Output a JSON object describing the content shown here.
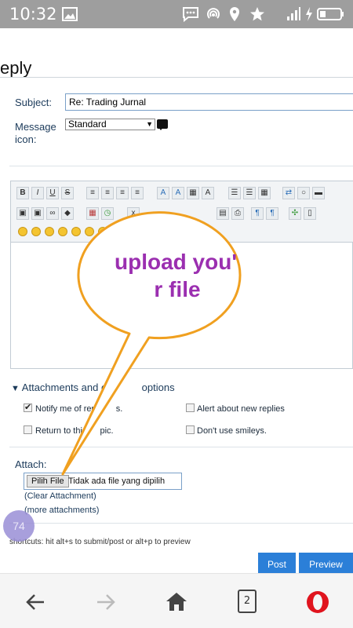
{
  "status_bar": {
    "time": "10:32"
  },
  "page": {
    "title": "eply",
    "subject_label": "Subject:",
    "subject_value": "Re: Trading Jurnal",
    "message_icon_label_1": "Message",
    "message_icon_label_2": "icon:",
    "message_icon_value": "Standard"
  },
  "editor": {
    "format_buttons": [
      "B",
      "I",
      "U",
      "S"
    ],
    "body_text": ""
  },
  "options": {
    "header": "Attachments and other options",
    "header_visible_1": "Attachments and oth",
    "header_visible_2": "options",
    "notify": {
      "label": "Notify me of replies.",
      "checked": true
    },
    "notify_visible_1": "Notify me of rep",
    "notify_visible_2": "s.",
    "alert": {
      "label": "Alert about new replies",
      "checked": false
    },
    "return": {
      "label": "Return to this topic.",
      "checked": false
    },
    "return_visible_1": "Return to this",
    "return_visible_2": "pic.",
    "smileys": {
      "label": "Don't use smileys.",
      "checked": false
    }
  },
  "attach": {
    "label": "Attach:",
    "button_label": "Pilih File",
    "no_file_text": "Tidak ada file yang dipilih",
    "clear_link": "(Clear Attachment)",
    "more_link": "(more attachments)"
  },
  "shortcuts_text": "shortcuts: hit alt+s to submit/post or alt+p to preview",
  "buttons": {
    "post": "Post",
    "preview": "Preview"
  },
  "floating_badge": "74",
  "callout": {
    "line1": "upload you'",
    "line2": "r file"
  },
  "navbar": {
    "tabs_count": "2"
  },
  "colors": {
    "status_bar": "#9e9e9e",
    "accent_blue": "#2b7fd8",
    "callout_orange": "#f0a020",
    "callout_text": "#9b2fb0",
    "opera_red": "#e0141e"
  }
}
